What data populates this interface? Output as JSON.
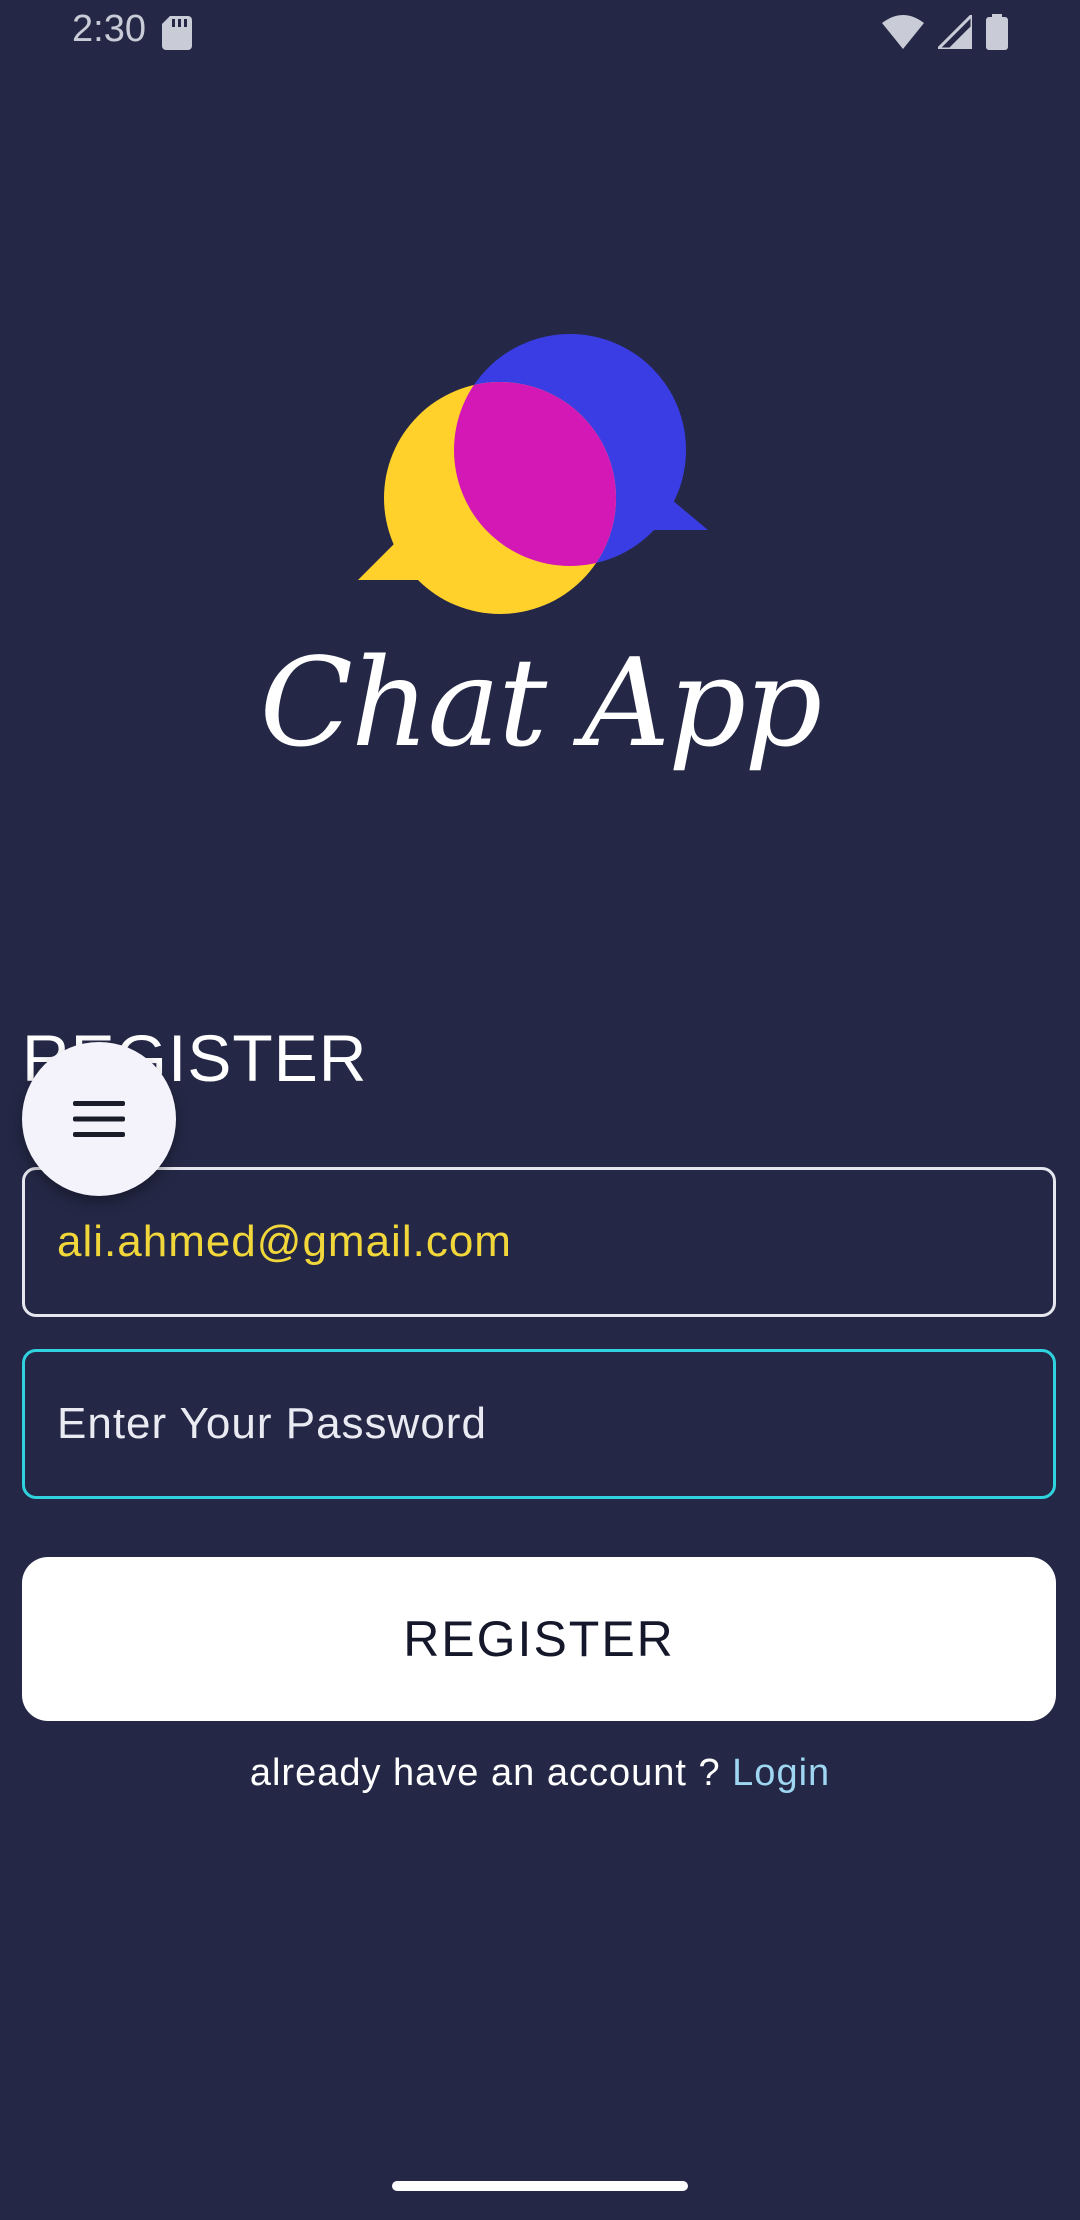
{
  "status_bar": {
    "time": "2:30",
    "icons": [
      "sd-card-icon",
      "wifi-icon",
      "signal-icon",
      "battery-icon"
    ]
  },
  "logo": {
    "title": "Chat App",
    "colors": {
      "yellow": "#ffd12a",
      "blue": "#3a3de3",
      "magenta": "#d318b5"
    }
  },
  "form": {
    "heading": "REGISTER",
    "email_value": "ali.ahmed@gmail.com",
    "password_placeholder": "Enter Your Password",
    "submit_label": "REGISTER",
    "login_prompt": "already have an account ?",
    "login_link": "Login"
  },
  "fab": {
    "icon": "menu-icon"
  },
  "colors": {
    "background": "#242846",
    "email_text": "#f2d73a",
    "focus_border": "#2fd3df",
    "link": "#9fd7f2"
  }
}
